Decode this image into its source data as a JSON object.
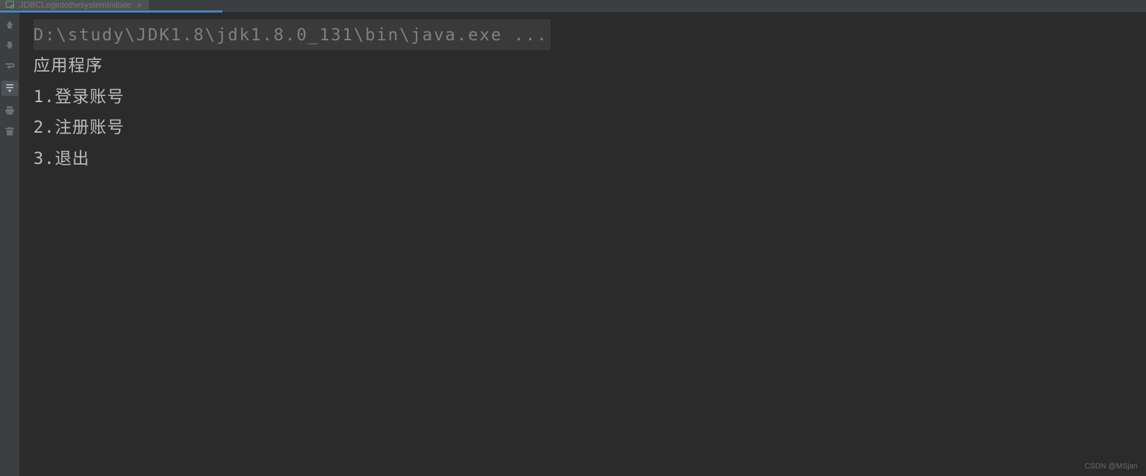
{
  "tab": {
    "label": "JDBCLogintothesystemInitiate",
    "close_symbol": "×"
  },
  "console": {
    "command": "D:\\study\\JDK1.8\\jdk1.8.0_131\\bin\\java.exe ...",
    "lines": [
      "应用程序",
      "1.登录账号",
      "2.注册账号",
      "3.退出"
    ]
  },
  "watermark": "CSDN @MSjan"
}
